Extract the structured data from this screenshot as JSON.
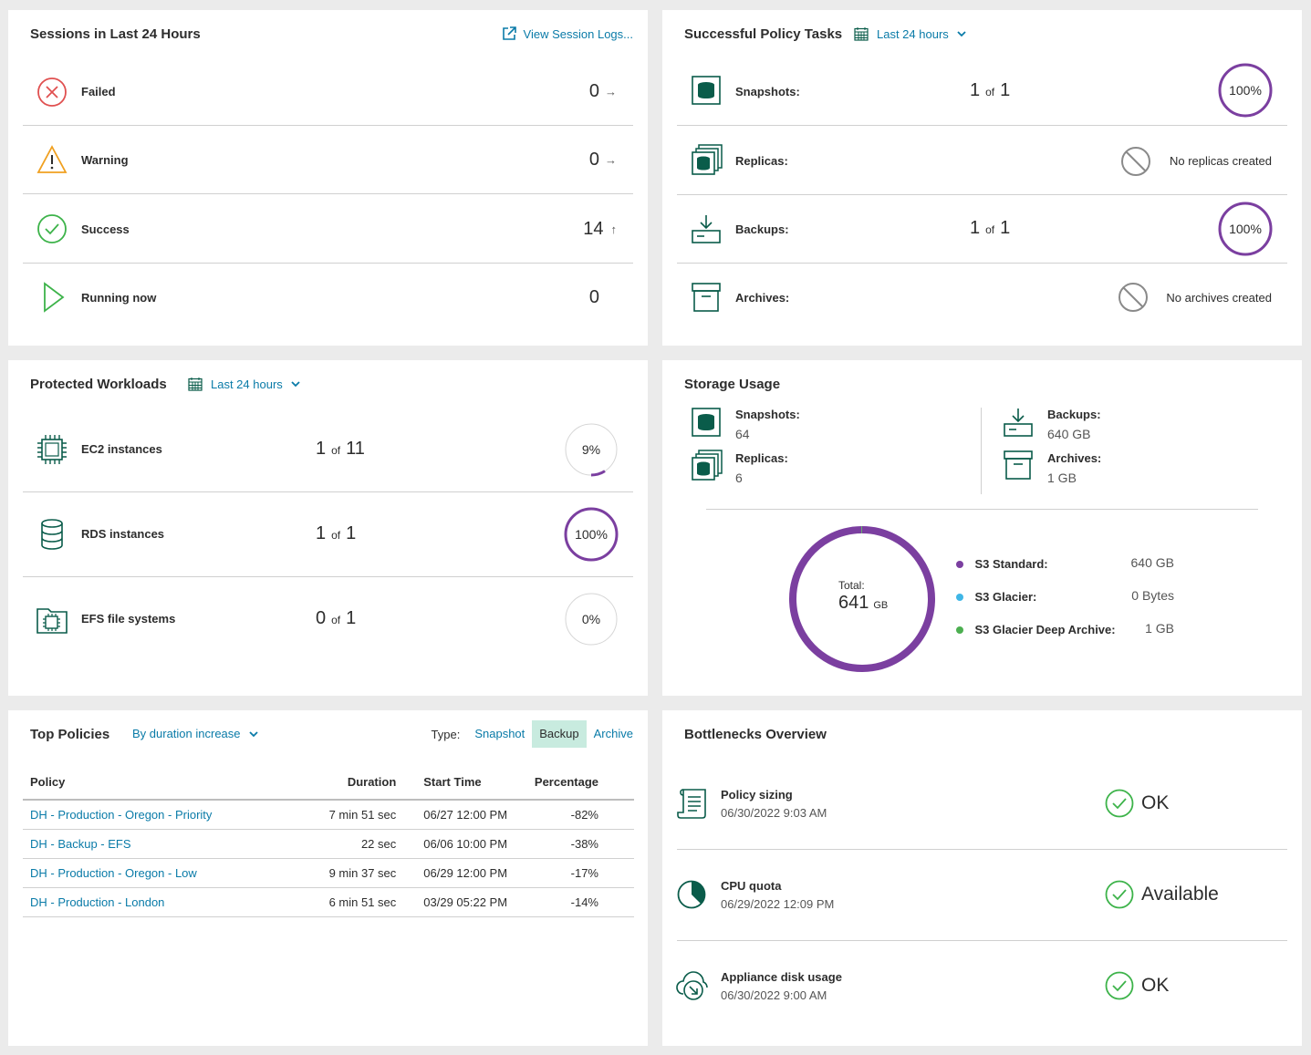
{
  "sessions": {
    "title": "Sessions in Last 24 Hours",
    "link": "View Session Logs...",
    "rows": [
      {
        "label": "Failed",
        "count": "0",
        "trend": "→"
      },
      {
        "label": "Warning",
        "count": "0",
        "trend": "→"
      },
      {
        "label": "Success",
        "count": "14",
        "trend": "↑"
      },
      {
        "label": "Running now",
        "count": "0",
        "trend": ""
      }
    ]
  },
  "policy_tasks": {
    "title": "Successful Policy Tasks",
    "period": "Last 24 hours",
    "of": "of",
    "rows": [
      {
        "label": "Snapshots:",
        "done": "1",
        "total": "1",
        "percent": "100%",
        "percent_value": 100
      },
      {
        "label": "Replicas:",
        "status": "No replicas created"
      },
      {
        "label": "Backups:",
        "done": "1",
        "total": "1",
        "percent": "100%",
        "percent_value": 100
      },
      {
        "label": "Archives:",
        "status": "No archives created"
      }
    ]
  },
  "workloads": {
    "title": "Protected Workloads",
    "period": "Last 24 hours",
    "of": "of",
    "rows": [
      {
        "label": "EC2 instances",
        "done": "1",
        "total": "11",
        "percent": "9%",
        "percent_value": 9
      },
      {
        "label": "RDS instances",
        "done": "1",
        "total": "1",
        "percent": "100%",
        "percent_value": 100
      },
      {
        "label": "EFS file systems",
        "done": "0",
        "total": "1",
        "percent": "0%",
        "percent_value": 0
      }
    ]
  },
  "storage": {
    "title": "Storage Usage",
    "snapshots_label": "Snapshots:",
    "snapshots_value": "64",
    "replicas_label": "Replicas:",
    "replicas_value": "6",
    "backups_label": "Backups:",
    "backups_value": "640 GB",
    "archives_label": "Archives:",
    "archives_value": "1 GB",
    "total_label": "Total:",
    "total_value": "641",
    "total_unit": "GB",
    "legend": [
      {
        "name": "S3 Standard:",
        "value": "640 GB",
        "color": "#7b3fa0",
        "amount": 640
      },
      {
        "name": "S3 Glacier:",
        "value": "0 Bytes",
        "color": "#3fb6e6",
        "amount": 0
      },
      {
        "name": "S3 Glacier Deep Archive:",
        "value": "1 GB",
        "color": "#4caf50",
        "amount": 1
      }
    ]
  },
  "top_policies": {
    "title": "Top Policies",
    "sort": "By duration increase",
    "type_label": "Type:",
    "types": [
      "Snapshot",
      "Backup",
      "Archive"
    ],
    "active_type": "Backup",
    "columns": [
      "Policy",
      "Duration",
      "Start Time",
      "Percentage"
    ],
    "rows": [
      [
        "DH - Production - Oregon - Priority",
        "7 min 51 sec",
        "06/27 12:00 PM",
        "-82%"
      ],
      [
        "DH - Backup - EFS",
        "22 sec",
        "06/06 10:00 PM",
        "-38%"
      ],
      [
        "DH - Production - Oregon - Low",
        "9 min 37 sec",
        "06/29 12:00 PM",
        "-17%"
      ],
      [
        "DH - Production - London",
        "6 min 51 sec",
        "03/29 05:22 PM",
        "-14%"
      ]
    ]
  },
  "bottlenecks": {
    "title": "Bottlenecks Overview",
    "rows": [
      {
        "label": "Policy sizing",
        "time": "06/30/2022 9:03 AM",
        "status": "OK"
      },
      {
        "label": "CPU quota",
        "time": "06/29/2022 12:09 PM",
        "status": "Available"
      },
      {
        "label": "Appliance disk usage",
        "time": "06/30/2022 9:00 AM",
        "status": "OK"
      }
    ]
  },
  "colors": {
    "accent": "#0a7ba8",
    "purple": "#7b3fa0",
    "green": "#3db34a",
    "teal": "#0a5c4a",
    "red": "#e05050",
    "amber": "#f0a020"
  }
}
